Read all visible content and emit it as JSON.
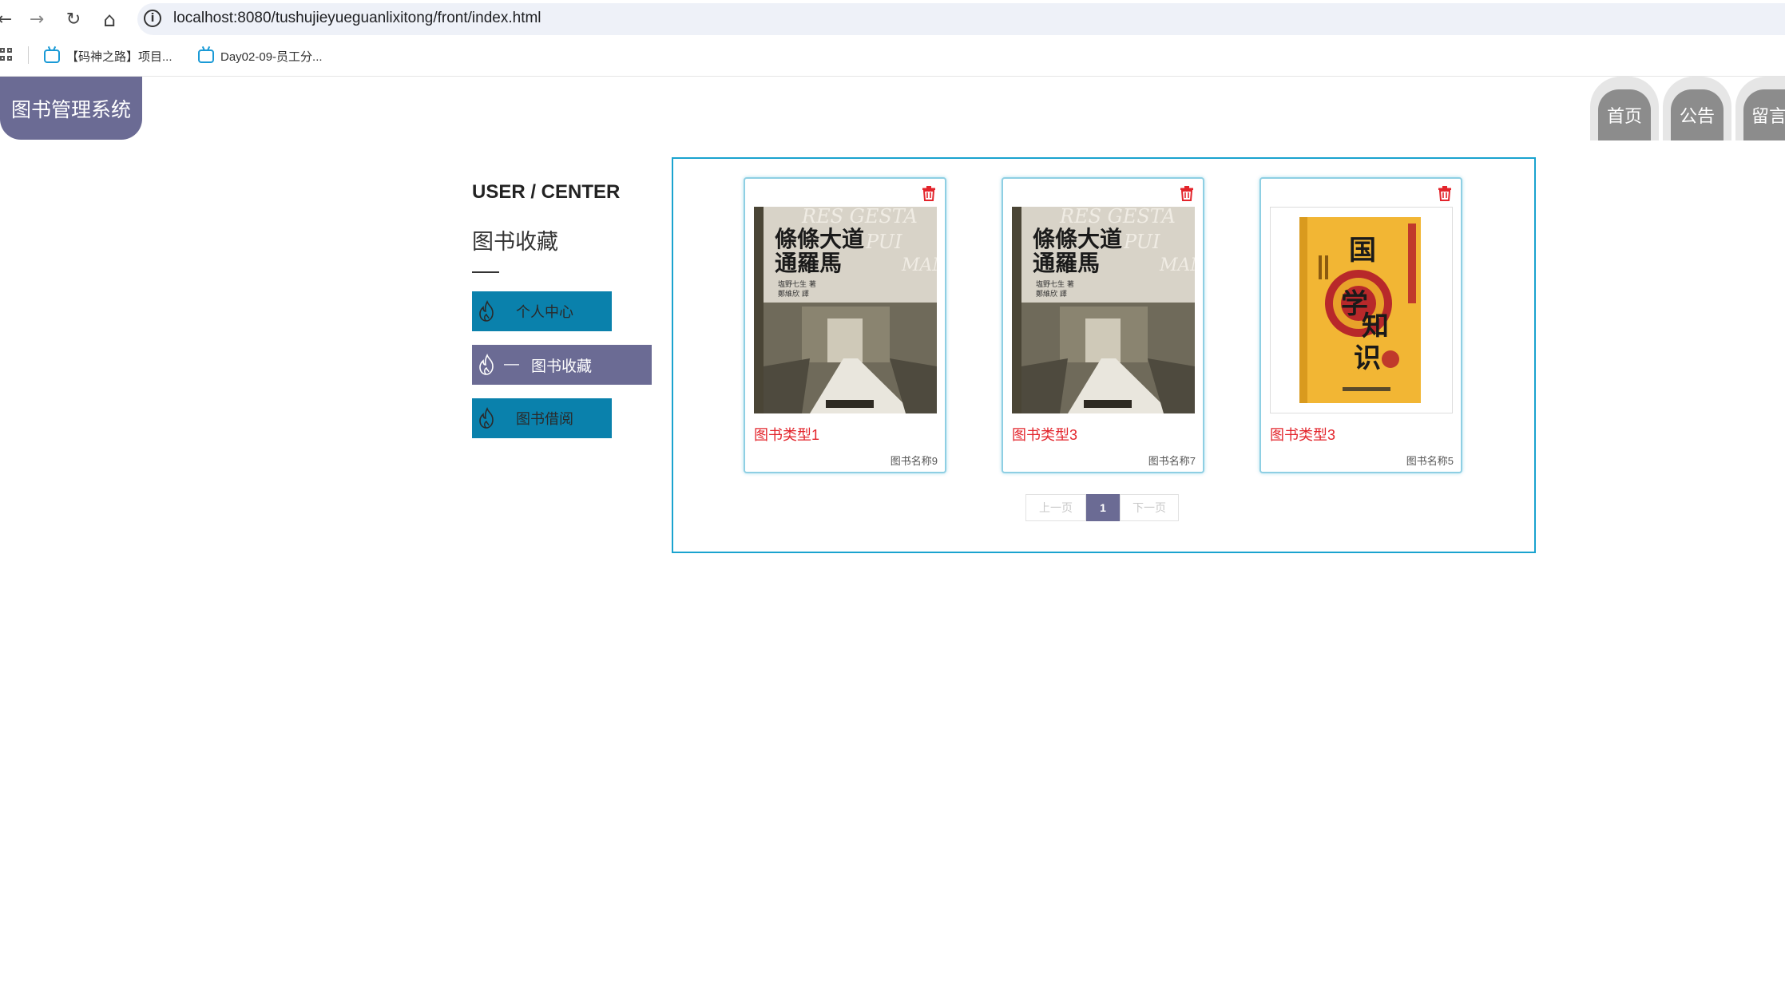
{
  "browser": {
    "url": "localhost:8080/tushujieyueguanlixitong/front/index.html",
    "nav_back": "←",
    "nav_forward": "→",
    "nav_reload": "↻",
    "nav_home": "⌂",
    "bookmarks": [
      {
        "label": "【码神之路】项目..."
      },
      {
        "label": "Day02-09-员工分..."
      }
    ]
  },
  "header": {
    "logo": "图书管理系统",
    "nav": [
      {
        "label": "首页"
      },
      {
        "label": "公告"
      },
      {
        "label": "留言板"
      }
    ]
  },
  "sidebar": {
    "title": "USER / CENTER",
    "subtitle": "图书收藏",
    "items": [
      {
        "label": "个人中心",
        "active": false
      },
      {
        "label": "图书收藏",
        "active": true,
        "prefix": "—"
      },
      {
        "label": "图书借阅",
        "active": false
      }
    ]
  },
  "cards": [
    {
      "type": "图书类型1",
      "name": "图书名称9",
      "cover": "rome-road-book-cover"
    },
    {
      "type": "图书类型3",
      "name": "图书名称7",
      "cover": "rome-road-book-cover"
    },
    {
      "type": "图书类型3",
      "name": "图书名称5",
      "cover": "guoxue-knowledge-book-cover"
    }
  ],
  "pagination": {
    "prev": "上一页",
    "current": "1",
    "next": "下一页"
  },
  "colors": {
    "accent_purple": "#6b6b94",
    "accent_blue": "#0a81ac",
    "border_blue": "#1aa3cf",
    "type_red": "#e3242b"
  }
}
